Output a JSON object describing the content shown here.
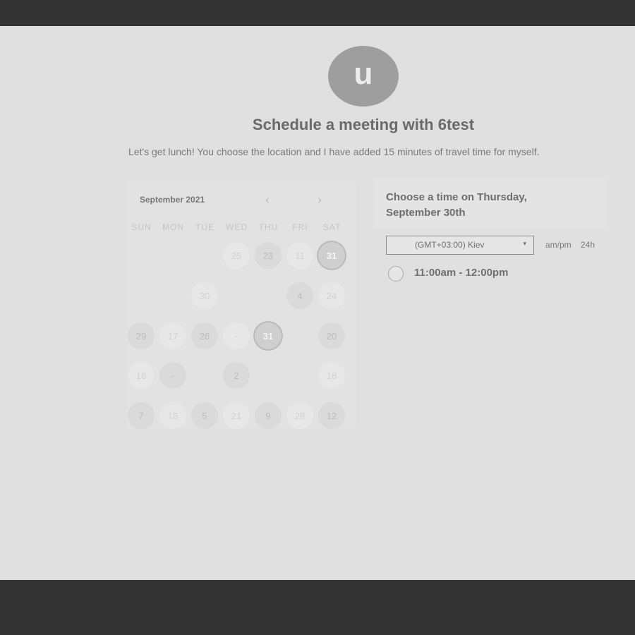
{
  "host": {
    "avatar_initial": "u",
    "title": "Schedule a meeting with 6test",
    "description": "Let's get lunch! You choose the location and I have added 15 minutes of travel time for myself."
  },
  "calendar": {
    "month_label": "September 2021",
    "prev_symbol": "‹",
    "next_symbol": "›",
    "weekdays": [
      "SUN",
      "MON",
      "TUE",
      "WED",
      "THU",
      "FRI",
      "SAT"
    ],
    "weeks": [
      [
        null,
        null,
        null,
        "25",
        "23",
        "11",
        "31"
      ],
      [
        null,
        null,
        "30",
        null,
        null,
        "4",
        "24"
      ],
      [
        "29",
        "17",
        "26",
        "-",
        "31",
        null,
        "20"
      ],
      [
        "16",
        "-",
        null,
        "2",
        null,
        null,
        "18"
      ],
      [
        "7",
        "18",
        "5",
        "21",
        "9",
        "28",
        "12"
      ]
    ],
    "selected_day": "31"
  },
  "time_picker": {
    "heading": "Choose a time on Thursday, September 30th",
    "timezone": "(GMT+03:00) Kiev",
    "caret": "▾",
    "format_ampm": "am/pm",
    "format_24h": "24h",
    "slots": [
      {
        "label": "11:00am - 12:00pm"
      }
    ]
  }
}
